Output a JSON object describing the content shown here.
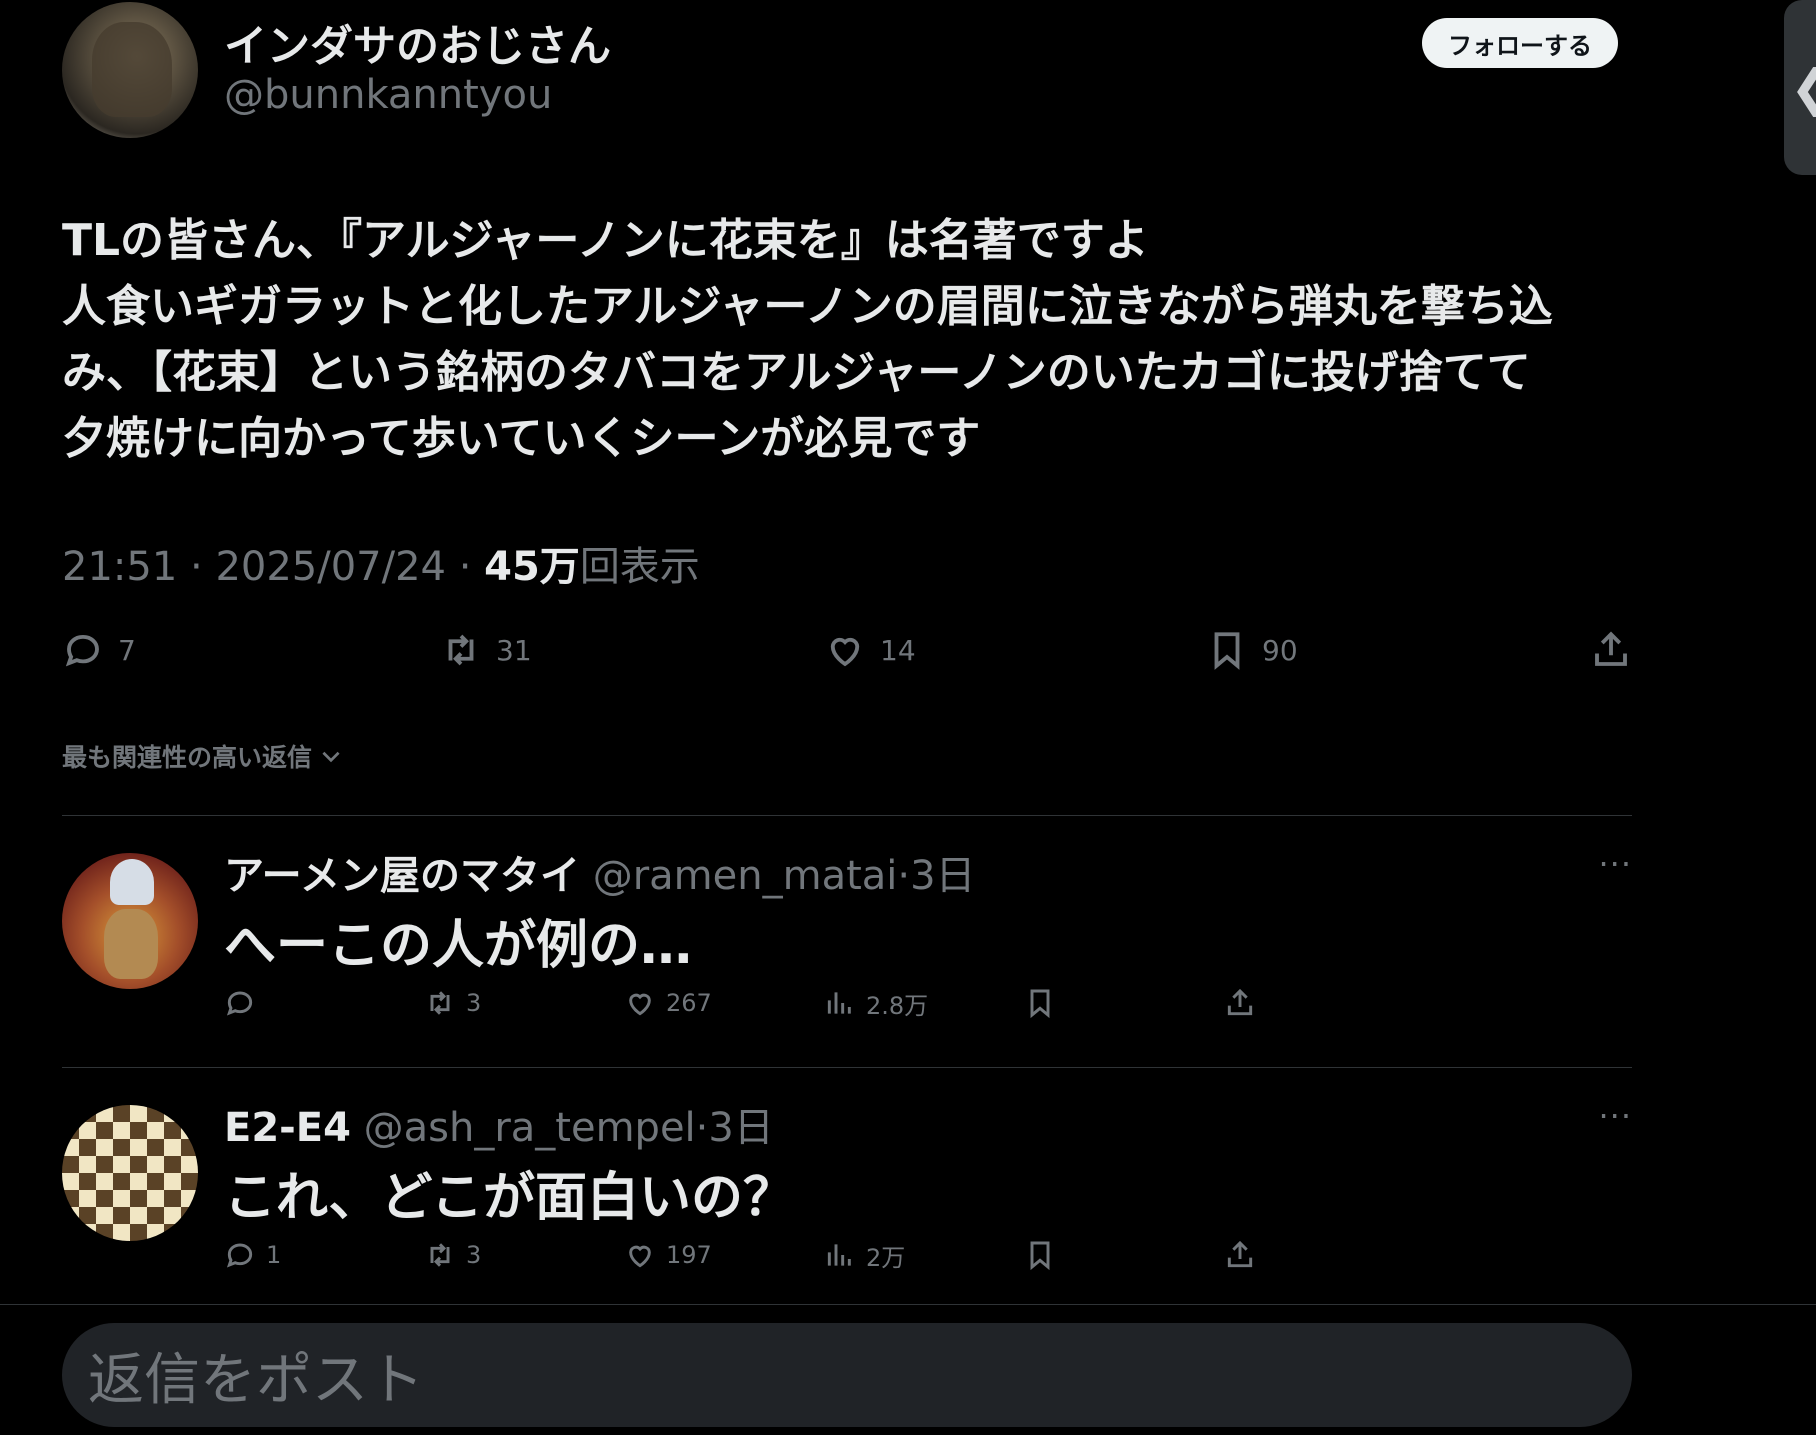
{
  "author": {
    "name": "インダサのおじさん",
    "handle": "@bunnkanntyou",
    "follow_label": "フォローする"
  },
  "side_tab": {
    "glyph": "❮"
  },
  "tweet": {
    "lines": [
      "TLの皆さん、『アルジャーノンに花束を』は名著ですよ",
      "人食いギガラットと化したアルジャーノンの眉間に泣きながら弾丸を撃ち込",
      "み、【花束】という銘柄のタバコをアルジャーノンのいたカゴに投げ捨てて",
      "夕焼けに向かって歩いていくシーンが必見です"
    ],
    "time": "21:51",
    "date": "2025/07/24",
    "views_count": "45万",
    "views_label": "回表示",
    "separator": "·",
    "stats": {
      "replies": "7",
      "retweets": "31",
      "likes": "14",
      "bookmarks": "90"
    }
  },
  "sort": {
    "label": "最も関連性の高い返信"
  },
  "replies": [
    {
      "name": "アーメン屋のマタイ",
      "handle": "@ramen_matai",
      "time": "3日",
      "text": "へーこの人が例の…",
      "more": "···",
      "stats": {
        "replies": "",
        "retweets": "3",
        "likes": "267",
        "views": "2.8万"
      }
    },
    {
      "name": "E2-E4",
      "handle": "@ash_ra_tempel",
      "time": "3日",
      "text": "これ、どこが面白いの？",
      "more": "···",
      "stats": {
        "replies": "1",
        "retweets": "3",
        "likes": "197",
        "views": "2万"
      }
    }
  ],
  "composer": {
    "placeholder": "返信をポスト"
  }
}
